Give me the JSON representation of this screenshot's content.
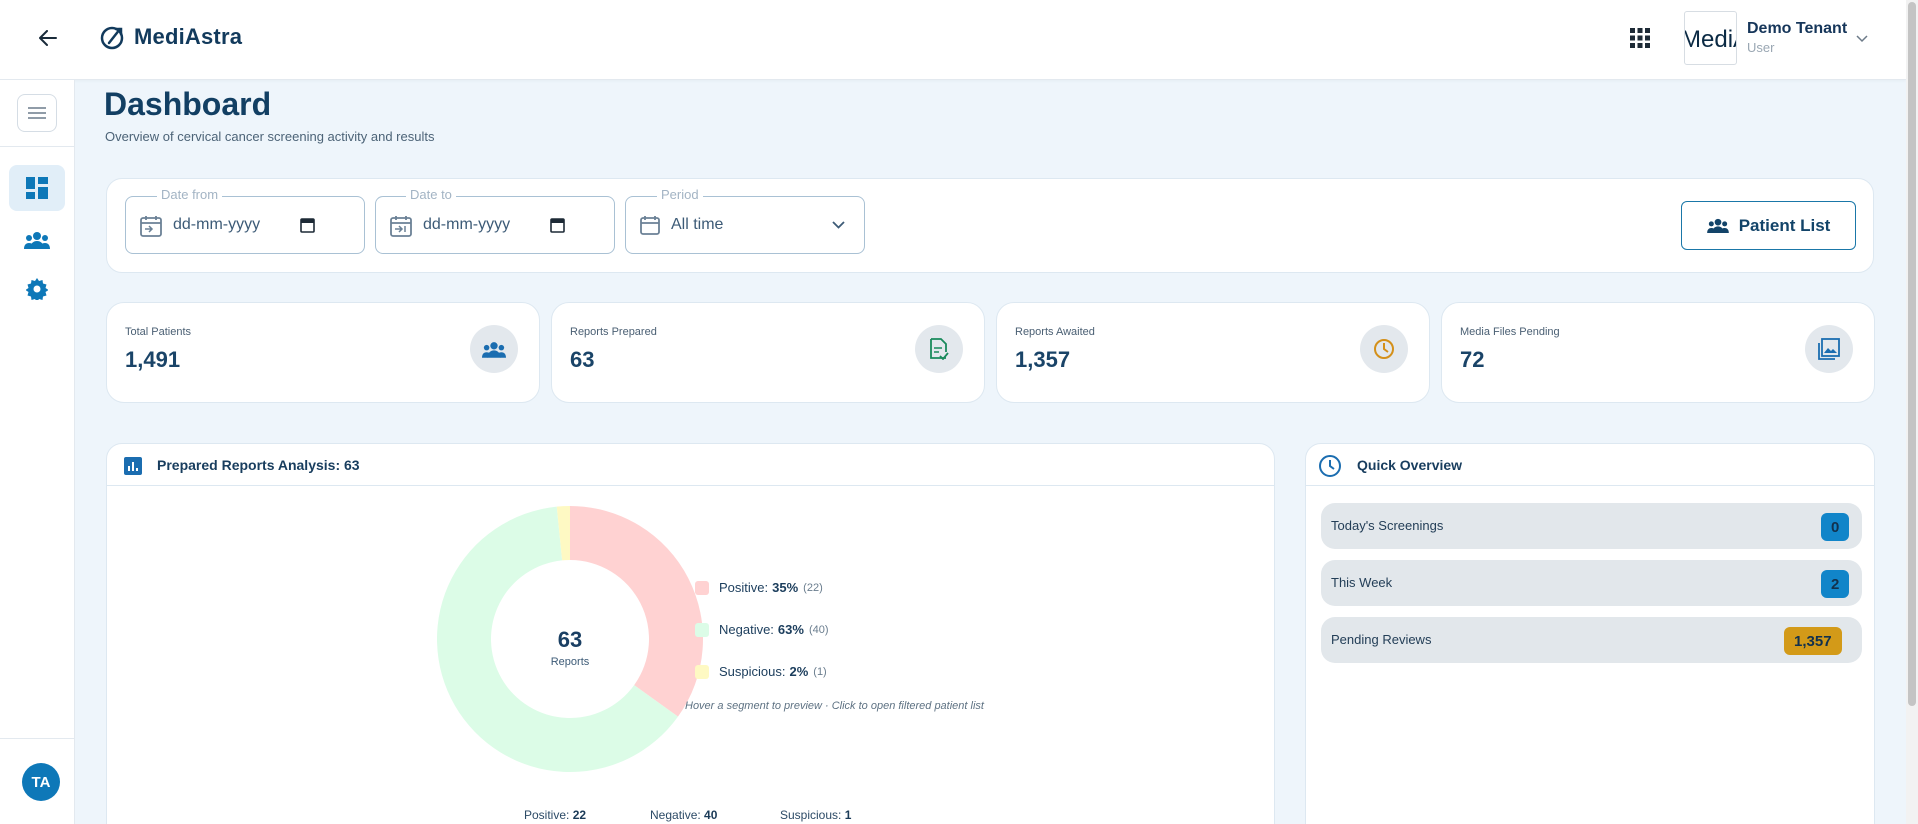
{
  "topbar": {
    "app_name": "MediAstra",
    "tenant_logo_text": "MediA",
    "tenant_name": "Demo Tenant",
    "tenant_role": "User"
  },
  "sidebar": {
    "items": [
      {
        "name": "dashboard",
        "icon": "dashboard-icon",
        "active": true
      },
      {
        "name": "patients",
        "icon": "people-icon",
        "active": false
      },
      {
        "name": "settings",
        "icon": "gear-icon",
        "active": false
      }
    ],
    "avatar_initials": "TA"
  },
  "header": {
    "title": "Dashboard",
    "subtitle": "Overview of cervical cancer screening activity and results"
  },
  "filters": {
    "date_from": {
      "label": "Date from",
      "value": "dd-mm-yyyy"
    },
    "date_to": {
      "label": "Date to",
      "value": "dd-mm-yyyy"
    },
    "period": {
      "label": "Period",
      "value": "All time"
    },
    "patient_list_label": "Patient List"
  },
  "stats": [
    {
      "label": "Total Patients",
      "value": "1,491",
      "icon": "people-icon"
    },
    {
      "label": "Reports Prepared",
      "value": "63",
      "icon": "document-check-icon"
    },
    {
      "label": "Reports Awaited",
      "value": "1,357",
      "icon": "clock-icon"
    },
    {
      "label": "Media Files Pending",
      "value": "72",
      "icon": "image-icon"
    }
  ],
  "analysis": {
    "title": "Prepared Reports Analysis: 63",
    "hint": "Hover a segment to preview · Click to open filtered patient list",
    "legend": [
      {
        "label": "Positive:",
        "pct": "35%",
        "count": "(22)"
      },
      {
        "label": "Negative:",
        "pct": "63%",
        "count": "(40)"
      },
      {
        "label": "Suspicious:",
        "pct": "2%",
        "count": "(1)"
      }
    ],
    "summary": [
      {
        "label": "Positive:",
        "value": "22"
      },
      {
        "label": "Negative:",
        "value": "40"
      },
      {
        "label": "Suspicious:",
        "value": "1"
      }
    ]
  },
  "chart_data": {
    "type": "pie",
    "variant": "donut",
    "center_value": "63",
    "center_label": "Reports",
    "categories": [
      "Positive",
      "Negative",
      "Suspicious"
    ],
    "values": [
      22,
      40,
      1
    ],
    "colors": [
      "#ffd2d2",
      "#dcfce7",
      "#fef9c3"
    ]
  },
  "quick_overview": {
    "title": "Quick Overview",
    "rows": [
      {
        "label": "Today's Screenings",
        "value": "0",
        "color": "#1185c9"
      },
      {
        "label": "This Week",
        "value": "2",
        "color": "#1185c9"
      },
      {
        "label": "Pending Reviews",
        "value": "1,357",
        "color": "#d39a18"
      }
    ]
  }
}
